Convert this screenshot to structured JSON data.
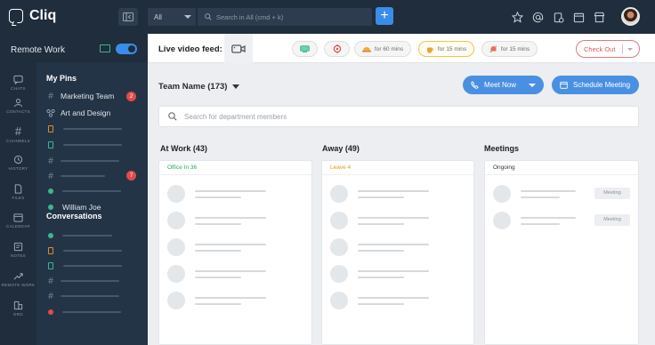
{
  "app": {
    "name": "Cliq"
  },
  "search": {
    "scope": "All",
    "placeholder": "Search in All (cmd + k)"
  },
  "remote_work": {
    "label": "Remote Work",
    "toggle_on": true
  },
  "rail": [
    {
      "label": "CHATS",
      "icon": "chat-icon"
    },
    {
      "label": "CONTACTS",
      "icon": "contact-icon"
    },
    {
      "label": "CHANNELS",
      "icon": "hash-icon"
    },
    {
      "label": "HISTORY",
      "icon": "history-icon"
    },
    {
      "label": "FILES",
      "icon": "file-icon"
    },
    {
      "label": "CALENDAR",
      "icon": "calendar-icon"
    },
    {
      "label": "NOTES",
      "icon": "notes-icon"
    },
    {
      "label": "REMOTE WORK",
      "icon": "remote-work-icon"
    },
    {
      "label": "ORG",
      "icon": "org-icon"
    }
  ],
  "sidebar": {
    "pins_title": "My Pins",
    "pins": [
      {
        "label": "Marketing Team",
        "type": "channel",
        "badge": "2"
      },
      {
        "label": "Art and Design",
        "type": "network"
      },
      {
        "type": "doc"
      },
      {
        "type": "doc-green"
      },
      {
        "type": "channel"
      },
      {
        "type": "channel",
        "badge": "7"
      },
      {
        "type": "dot"
      },
      {
        "label": "William Joe",
        "type": "dot"
      }
    ],
    "conversations_title": "Conversations"
  },
  "feed": {
    "label": "Live video feed:",
    "chips": [
      {
        "label": "",
        "icon": "monitor-icon"
      },
      {
        "label": "",
        "icon": "target-icon"
      },
      {
        "label": "for 60 mins",
        "icon": "lunch-icon"
      },
      {
        "label": "for 15 mins",
        "icon": "coffee-icon",
        "active": true
      },
      {
        "label": "for 15 mins",
        "icon": "snooze-icon"
      }
    ],
    "checkout_label": "Check Out"
  },
  "team": {
    "name": "Team Name (173)",
    "meet_now": "Meet Now",
    "schedule_meeting": "Schedule Meeting",
    "search_placeholder": "Search for department members"
  },
  "columns": [
    {
      "title": "At Work (43)",
      "status": "Office In 36",
      "status_color": "#2fa565"
    },
    {
      "title": "Away (49)",
      "status": "Leave 4",
      "status_color": "#e69a12"
    },
    {
      "title": "Meetings",
      "status": "Ongoing",
      "status_color": "#333333",
      "tag": "Meeting"
    }
  ],
  "colors": {
    "accent": "#4a90e2",
    "badge": "#e5484d",
    "online": "#3fb58e"
  }
}
